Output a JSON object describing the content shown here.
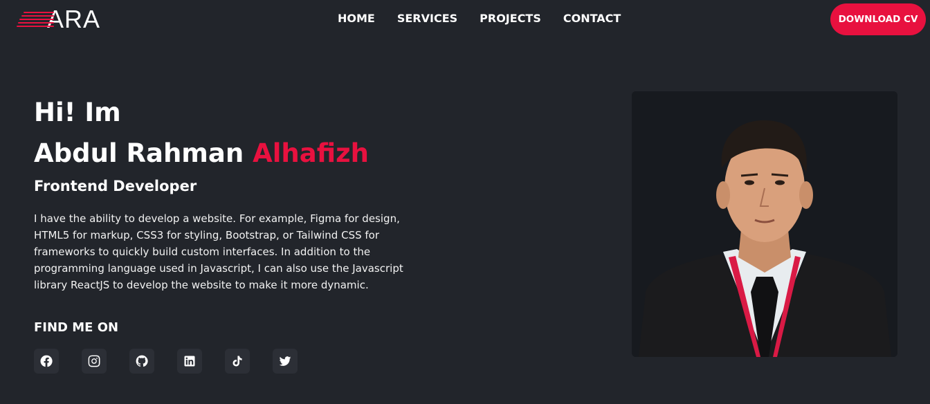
{
  "brand": {
    "logo_text": "ARA",
    "accent_color": "#e8113f",
    "background": "#22252b"
  },
  "nav": {
    "items": [
      {
        "label": "HOME"
      },
      {
        "label": "SERVICES"
      },
      {
        "label": "PROJECTS"
      },
      {
        "label": "CONTACT"
      }
    ],
    "cta_label": "DOWNLOAD CV"
  },
  "hero": {
    "greeting": "Hi! Im",
    "name_first": "Abdul Rahman",
    "name_accent": "Alhafizh",
    "role": "Frontend Developer",
    "bio": "I have the ability to develop a website. For example, Figma for design, HTML5 for markup, CSS3 for styling, Bootstrap, or Tailwind CSS for frameworks to quickly build custom interfaces. In addition to the programming language used in Javascript, I can also use the Javascript library ReactJS to develop the website to make it more dynamic."
  },
  "social": {
    "heading": "FIND ME ON",
    "links": [
      {
        "icon": "facebook-icon"
      },
      {
        "icon": "instagram-icon"
      },
      {
        "icon": "github-icon"
      },
      {
        "icon": "linkedin-icon"
      },
      {
        "icon": "tiktok-icon"
      },
      {
        "icon": "twitter-icon"
      }
    ]
  },
  "photo": {
    "icon": "profile-photo"
  }
}
